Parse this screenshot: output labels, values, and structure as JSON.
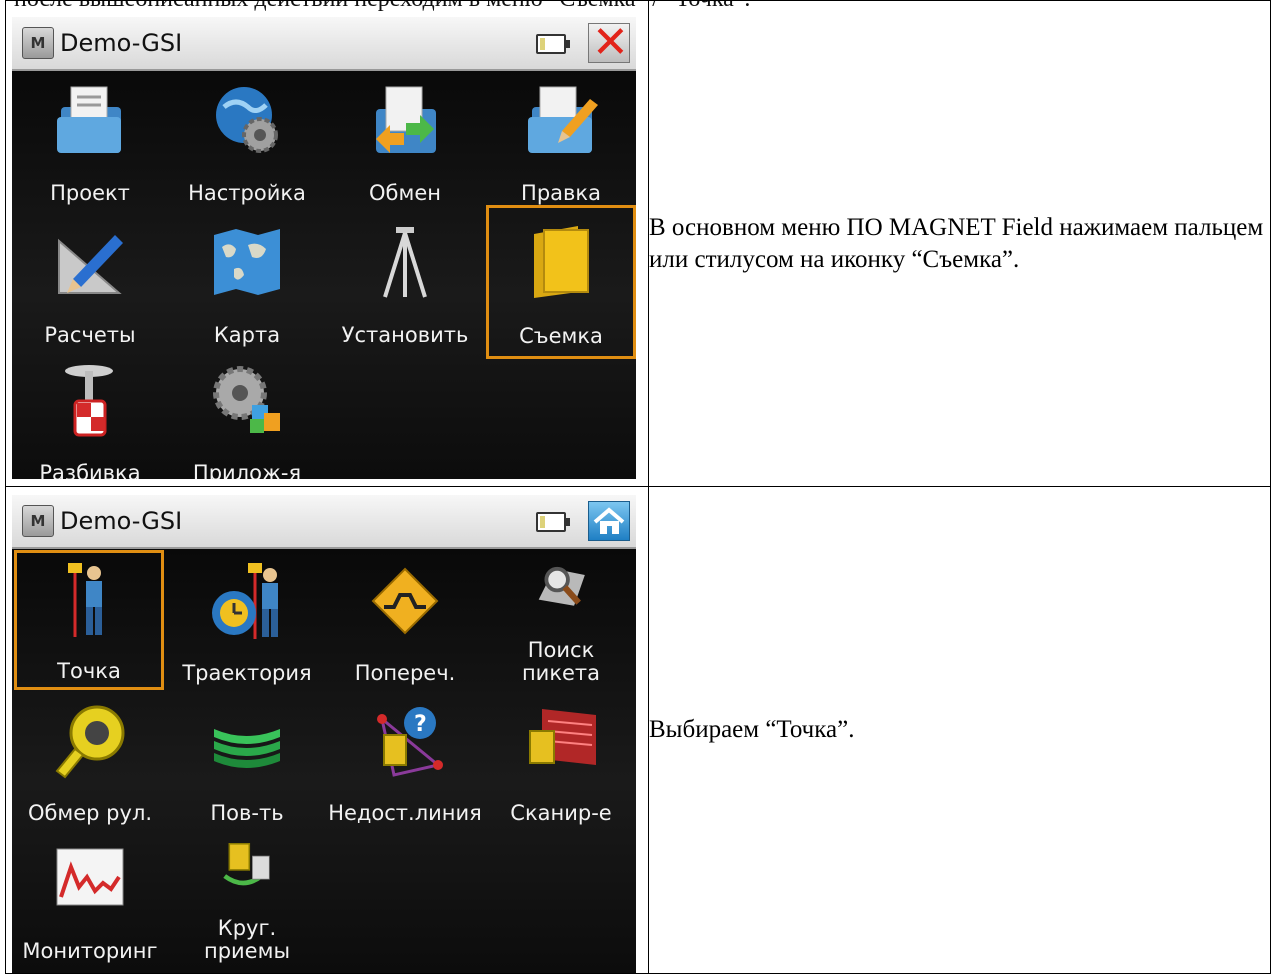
{
  "top_line": "после вышеописанных действий переходим в меню “Съемка” / “Точка”.",
  "rows": [
    {
      "screen": {
        "app_title": "Demo-GSI",
        "logo": "M",
        "corner_button": "close-icon",
        "tiles": [
          "Проект",
          "Настройка",
          "Обмен",
          "Правка",
          "Расчеты",
          "Карта",
          "Установить",
          "Съемка",
          "Разбивка",
          "Прилож-я"
        ],
        "selected": "Съемка"
      },
      "text": "В основном меню ПО MAGNET Field нажимаем пальцем или стилусом на иконку “Съемка”."
    },
    {
      "screen": {
        "app_title": "Demo-GSI",
        "logo": "M",
        "corner_button": "home-icon",
        "tiles": [
          "Точка",
          "Траектория",
          "Попереч.",
          "Поиск\nпикета",
          "Обмер рул.",
          "Пов-ть",
          "Недост.линия",
          "Сканир-е",
          "Мониторинг",
          "Круг.\nприемы"
        ],
        "selected": "Точка"
      },
      "text": "Выбираем “Точка”."
    }
  ],
  "colors": {
    "selection": "#e08e12",
    "screen_bg": "#0d0d0d",
    "close": "#e2231a"
  }
}
